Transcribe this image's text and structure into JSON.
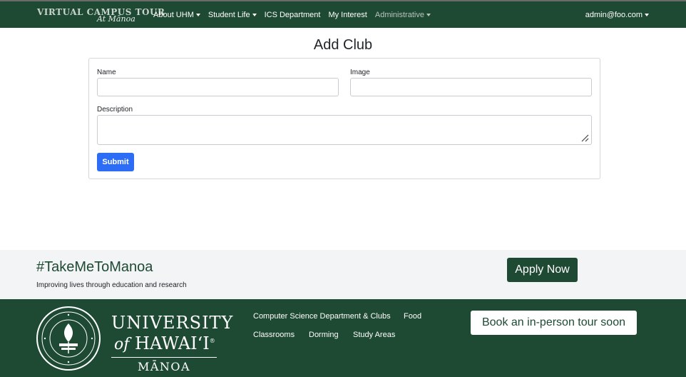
{
  "navbar": {
    "brand_top": "VIRTUAL CAMPUS TOUR",
    "brand_sub": "At Mānoa",
    "items": [
      {
        "label": "About UHM",
        "dropdown": true
      },
      {
        "label": "Student Life",
        "dropdown": true
      },
      {
        "label": "ICS Department",
        "dropdown": false
      },
      {
        "label": "My Interest",
        "dropdown": false
      },
      {
        "label": "Administrative",
        "dropdown": true
      }
    ],
    "user": "admin@foo.com"
  },
  "form": {
    "title": "Add Club",
    "name_label": "Name",
    "name_value": "",
    "image_label": "Image",
    "image_value": "",
    "description_label": "Description",
    "description_value": "",
    "submit_label": "Submit"
  },
  "footer_top": {
    "hashtag": "#TakeMeToManoa",
    "tagline": "Improving lives through education and research",
    "apply_label": "Apply Now"
  },
  "footer_bottom": {
    "university_line1": "UNIVERSITY",
    "university_of": "of",
    "university_line2": "HAWAIʻI",
    "university_registered": "®",
    "university_line3": "MĀNOA",
    "links_row1": [
      "Computer Science Department & Clubs",
      "Food"
    ],
    "links_row2": [
      "Classrooms",
      "Dorming",
      "Study Areas"
    ],
    "tour_label": "Book an in-person tour soon"
  },
  "colors": {
    "brand_green": "#1e4a34",
    "submit_blue": "#2d6df6",
    "footer_light": "#f3f4f6"
  },
  "icons": {
    "caret": "caret-down-icon",
    "seal": "university-seal-icon",
    "resize": "textarea-resize-icon"
  }
}
